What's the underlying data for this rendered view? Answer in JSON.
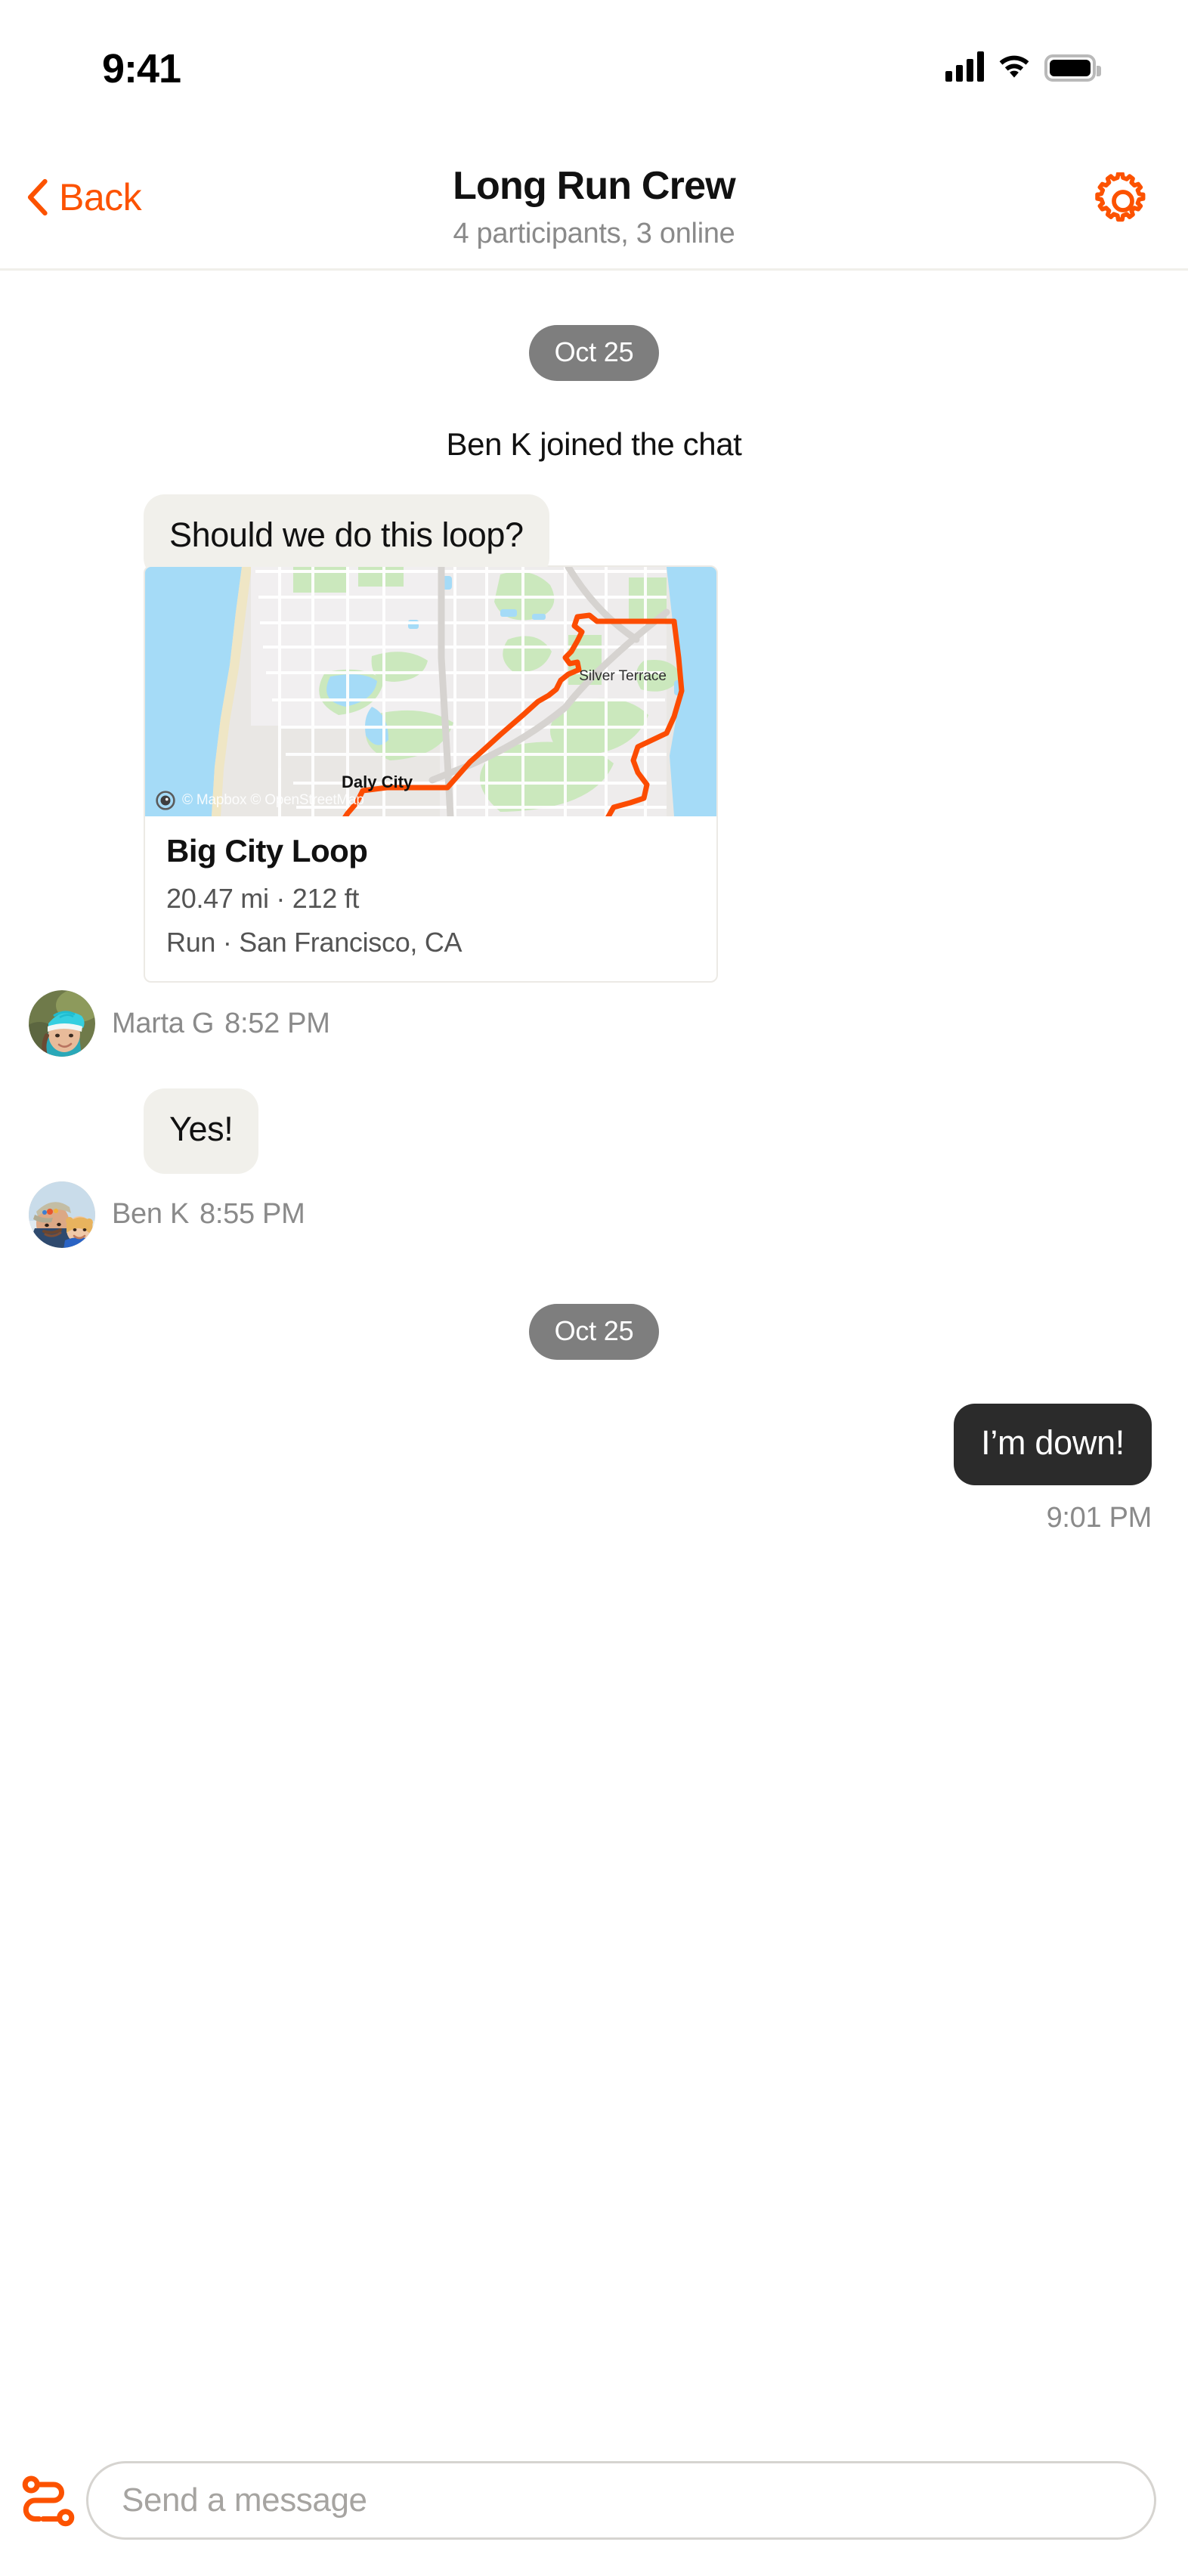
{
  "status_bar": {
    "time": "9:41",
    "signal_icon": "cellular-signal-icon",
    "wifi_icon": "wifi-icon",
    "battery_icon": "battery-full-icon"
  },
  "header": {
    "back_label": "Back",
    "back_icon": "chevron-left-icon",
    "title": "Long Run Crew",
    "subtitle": "4 participants, 3 online",
    "settings_icon": "gear-icon"
  },
  "thread": {
    "date_divider_top": "Oct 25",
    "date_divider_bottom": "Oct 25",
    "system_message": "Ben K joined the chat",
    "message_1": {
      "text": "Should we do this loop?",
      "sender": "Marta G",
      "time": "8:52 PM",
      "avatar_icon": "avatar-marta-cyclist-helmet"
    },
    "route_card": {
      "name": "Big City Loop",
      "stats": "20.47 mi · 212 ft",
      "meta": "Run · San Francisco, CA",
      "map_attribution": "© Mapbox © OpenStreetMap",
      "map_labels": [
        "Silver Terrace",
        "Daly City"
      ],
      "route_color": "#FC4C02",
      "attribution_badge_icon": "mapbox-info-icon"
    },
    "message_2": {
      "text": "Yes!",
      "sender": "Ben K",
      "time": "8:55 PM",
      "avatar_icon": "avatar-ben-cap-with-child"
    },
    "message_3": {
      "text": "I’m down!",
      "time": "9:01 PM",
      "outgoing": true
    }
  },
  "composer": {
    "attach_route_icon": "route-attach-icon",
    "placeholder": "Send a message",
    "value": ""
  },
  "colors": {
    "accent": "#FC5200",
    "route": "#FC4C02",
    "bubble_in": "#F1F0EB",
    "bubble_out": "#2B2B2B",
    "date_pill": "#7E7E7E",
    "muted_text": "#8A8A8A"
  }
}
